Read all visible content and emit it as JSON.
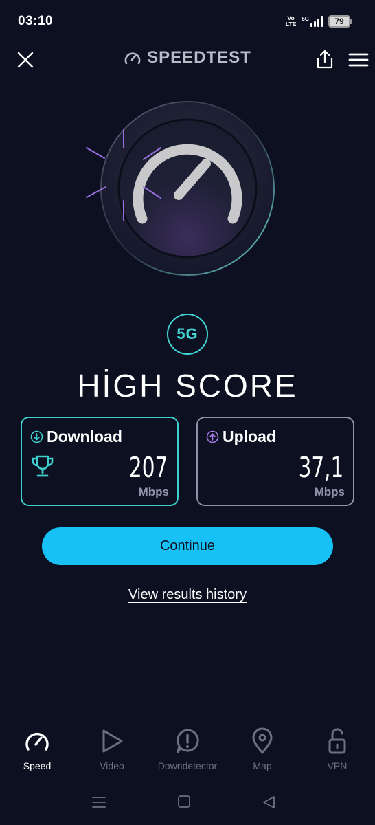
{
  "status": {
    "time": "03:10",
    "volte_top": "Vo",
    "volte_bottom": "LTE",
    "network": "5G",
    "battery": "79"
  },
  "header": {
    "brand": "SPEEDTEST"
  },
  "result": {
    "badge": "5G",
    "title": "HİGH SCORE"
  },
  "download": {
    "label": "Download",
    "value": "207",
    "unit": "Mbps"
  },
  "upload": {
    "label": "Upload",
    "value": "37,1",
    "unit": "Mbps"
  },
  "actions": {
    "continue_label": "Continue",
    "history_label": "View results history"
  },
  "tabs": [
    {
      "label": "Speed",
      "icon": "speedometer-icon",
      "active": true
    },
    {
      "label": "Video",
      "icon": "play-icon",
      "active": false
    },
    {
      "label": "Downdetector",
      "icon": "alert-icon",
      "active": false
    },
    {
      "label": "Map",
      "icon": "map-pin-icon",
      "active": false
    },
    {
      "label": "VPN",
      "icon": "lock-icon",
      "active": false
    }
  ],
  "colors": {
    "background": "#0c1020",
    "accent": "#17c1f5",
    "teal": "#41d6d4",
    "purple": "#a77be8"
  }
}
